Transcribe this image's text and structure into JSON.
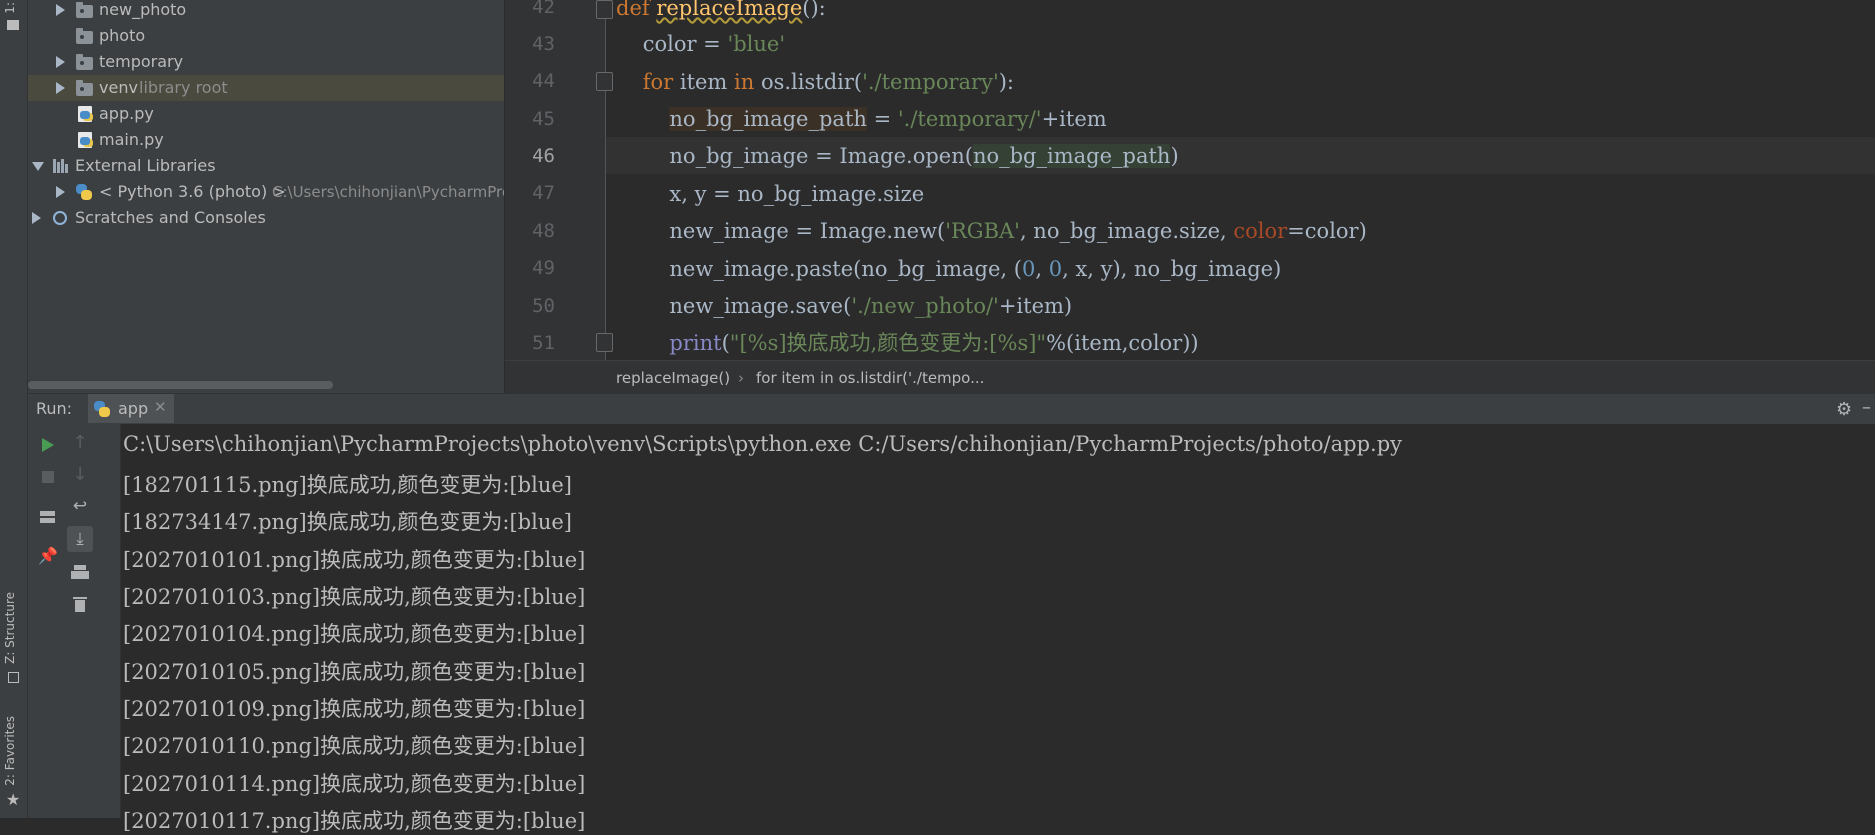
{
  "left_strip": {
    "project_tab": "1:",
    "structure_tab": "Z: Structure",
    "favorites_tab": "2: Favorites"
  },
  "project_tree": {
    "items": [
      {
        "label": "new_photo",
        "suffix": ""
      },
      {
        "label": "photo",
        "suffix": ""
      },
      {
        "label": "temporary",
        "suffix": ""
      },
      {
        "label": "venv",
        "suffix": "library root"
      },
      {
        "label": "app.py",
        "suffix": ""
      },
      {
        "label": "main.py",
        "suffix": ""
      },
      {
        "label": "External Libraries",
        "suffix": ""
      },
      {
        "label": "< Python 3.6 (photo) >",
        "suffix": "C:\\Users\\chihonjian\\PycharmPro"
      },
      {
        "label": "Scratches and Consoles",
        "suffix": ""
      }
    ]
  },
  "editor": {
    "line_numbers": [
      "42",
      "43",
      "44",
      "45",
      "46",
      "47",
      "48",
      "49",
      "50",
      "51"
    ],
    "current_line": "46",
    "breadcrumb": [
      "replaceImage()",
      "for item in os.listdir('./tempo..."
    ]
  },
  "run": {
    "label": "Run:",
    "tab_name": "app",
    "console_lines": [
      "C:\\Users\\chihonjian\\PycharmProjects\\photo\\venv\\Scripts\\python.exe C:/Users/chihonjian/PycharmProjects/photo/app.py",
      "[182701115.png]换底成功,颜色变更为:[blue]",
      "[182734147.png]换底成功,颜色变更为:[blue]",
      "[2027010101.png]换底成功,颜色变更为:[blue]",
      "[2027010103.png]换底成功,颜色变更为:[blue]",
      "[2027010104.png]换底成功,颜色变更为:[blue]",
      "[2027010105.png]换底成功,颜色变更为:[blue]",
      "[2027010109.png]换底成功,颜色变更为:[blue]",
      "[2027010110.png]换底成功,颜色变更为:[blue]",
      "[2027010114.png]换底成功,颜色变更为:[blue]",
      "[2027010117.png]换底成功,颜色变更为:[blue]"
    ]
  },
  "colors": {
    "keyword": "#cc7832",
    "string": "#6a8759",
    "function": "#ffc66d",
    "number": "#6897bb",
    "run_green": "#499c54"
  }
}
